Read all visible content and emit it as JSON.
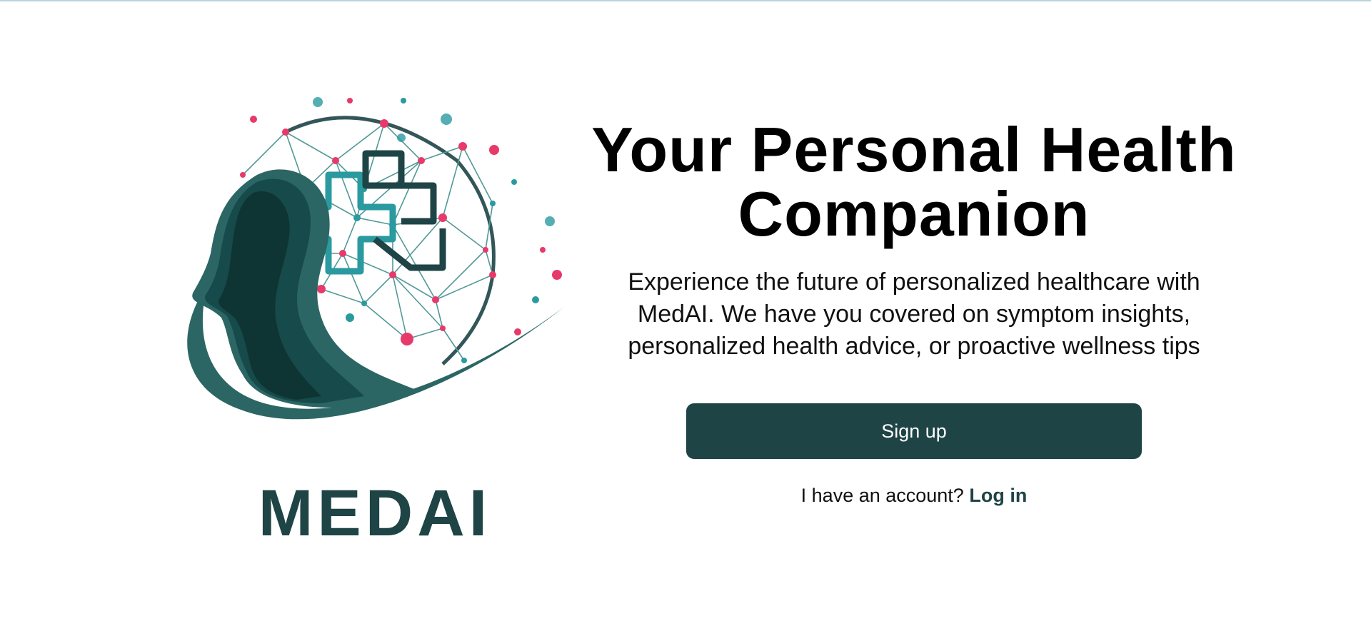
{
  "hero": {
    "title": "Your Personal Health Companion",
    "subtitle": "Experience the future of personalized healthcare with MedAI. We have you covered on symptom insights, personalized health advice, or proactive wellness tips"
  },
  "actions": {
    "signup_label": "Sign up",
    "login_prompt": "I have an account?",
    "login_label": "Log in"
  },
  "logo": {
    "wordmark": "MEDAI",
    "icon": "head-profile-with-medical-cross-network-icon"
  },
  "colors": {
    "brand_dark": "#1e4446",
    "brand_teal": "#2a9aa0",
    "accent_pink": "#e8396b",
    "top_rule": "#b9d3de"
  }
}
